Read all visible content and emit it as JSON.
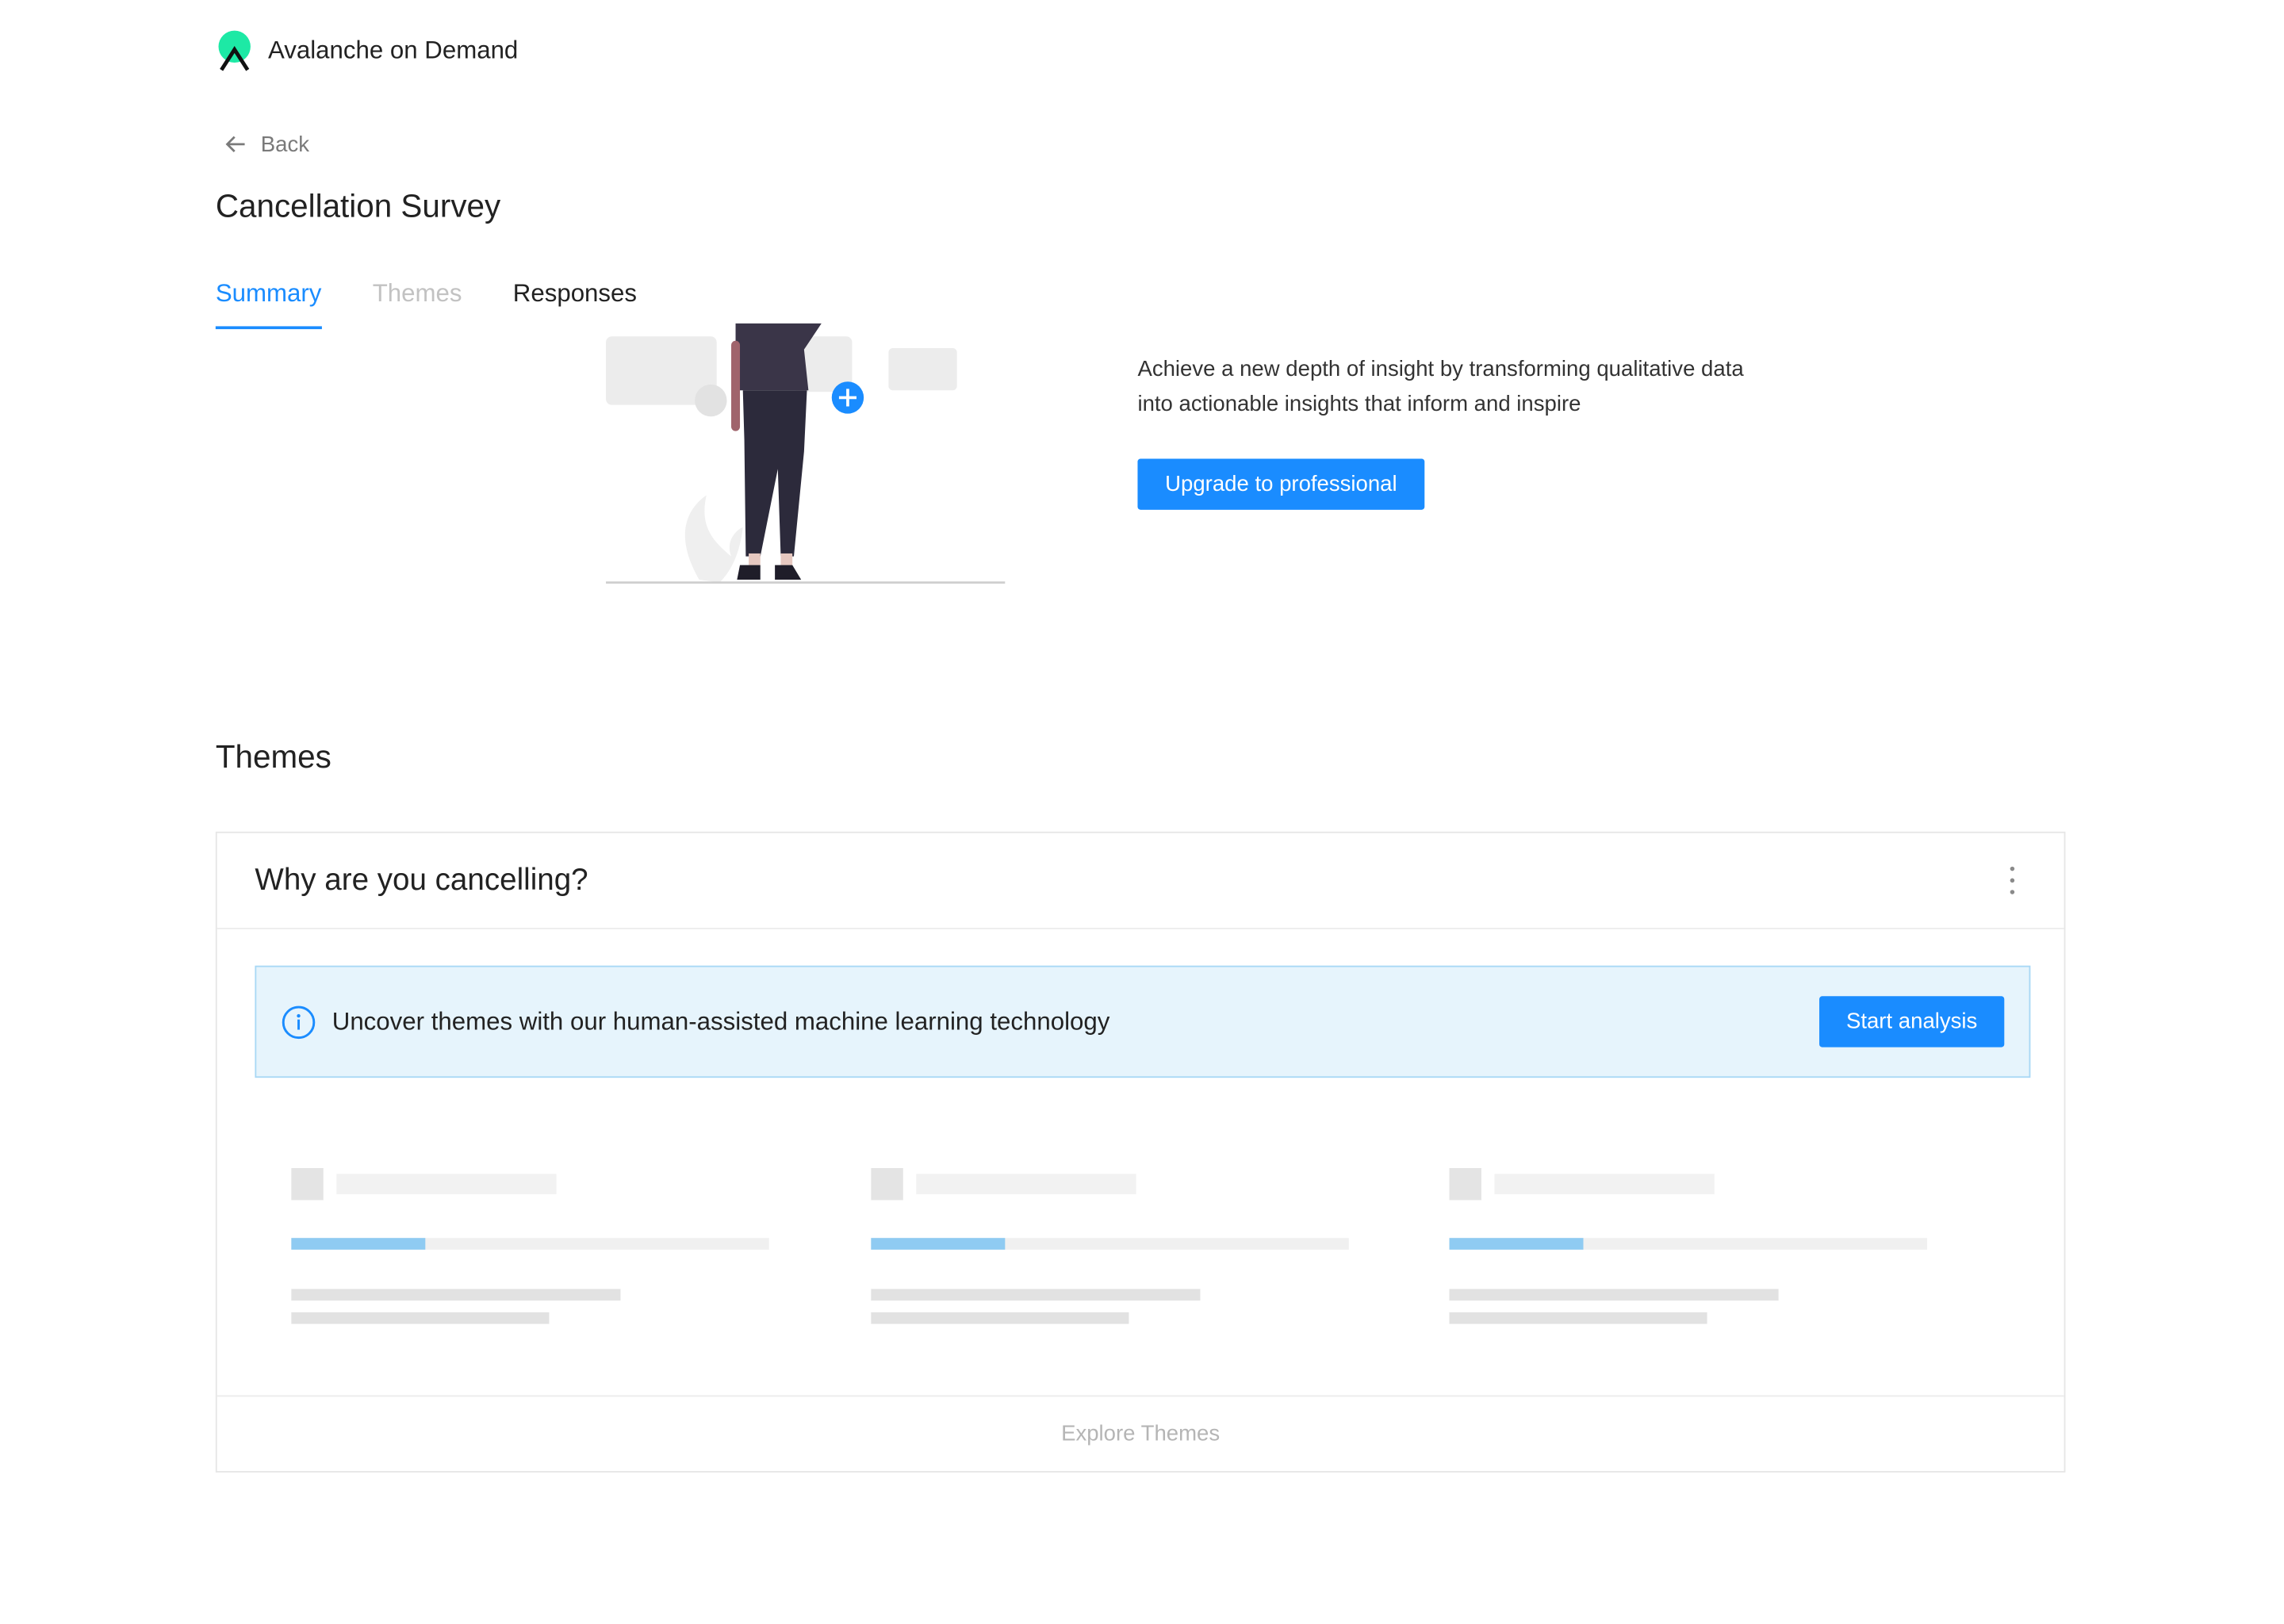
{
  "app": {
    "name": "Avalanche on Demand",
    "logo_icon": "avalanche-logo-icon",
    "accent": "#1a8cff",
    "brand_green": "#1de9a5"
  },
  "nav": {
    "back_label": "Back",
    "back_icon": "arrow-left-icon"
  },
  "page": {
    "title": "Cancellation Survey"
  },
  "tabs": [
    {
      "label": "Summary",
      "state": "active"
    },
    {
      "label": "Themes",
      "state": "disabled"
    },
    {
      "label": "Responses",
      "state": "default"
    }
  ],
  "promo": {
    "text": "Achieve a new depth of insight by transforming qualitative data into actionable insights that inform and inspire",
    "button_label": "Upgrade to professional"
  },
  "themes_section": {
    "title": "Themes",
    "question": "Why are you cancelling?",
    "menu_icon": "more-vertical-icon",
    "banner": {
      "icon": "info-icon",
      "text": "Uncover themes with our human-assisted machine learning technology",
      "button_label": "Start analysis"
    },
    "placeholder_cards": 3,
    "footer_link": "Explore Themes"
  }
}
